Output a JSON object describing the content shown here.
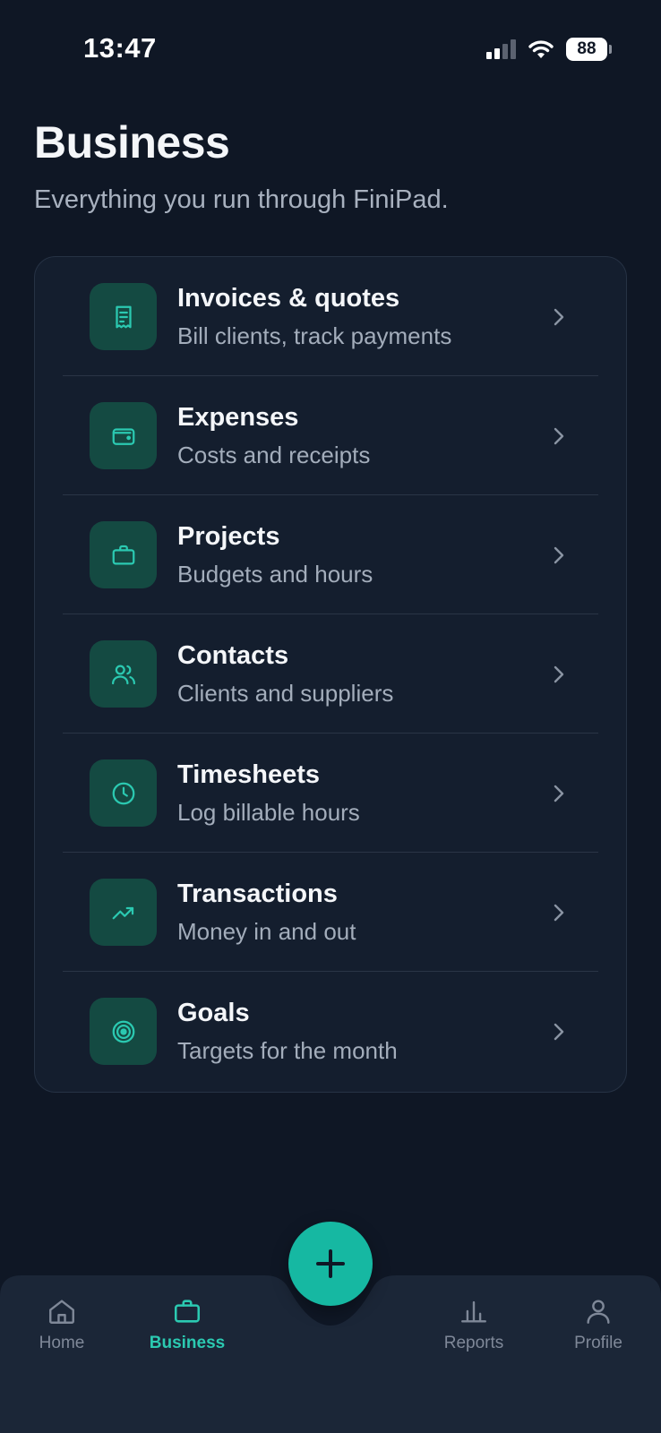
{
  "status_bar": {
    "time": "13:47",
    "battery": "88"
  },
  "header": {
    "title": "Business",
    "subtitle": "Everything you run through FiniPad."
  },
  "menu": {
    "items": [
      {
        "title": "Invoices & quotes",
        "subtitle": "Bill clients, track payments",
        "icon": "receipt-icon"
      },
      {
        "title": "Expenses",
        "subtitle": "Costs and receipts",
        "icon": "wallet-icon"
      },
      {
        "title": "Projects",
        "subtitle": "Budgets and hours",
        "icon": "briefcase-icon"
      },
      {
        "title": "Contacts",
        "subtitle": "Clients and suppliers",
        "icon": "users-icon"
      },
      {
        "title": "Timesheets",
        "subtitle": "Log billable hours",
        "icon": "clock-icon"
      },
      {
        "title": "Transactions",
        "subtitle": "Money in and out",
        "icon": "trending-up-icon"
      },
      {
        "title": "Goals",
        "subtitle": "Targets for the month",
        "icon": "target-icon"
      }
    ]
  },
  "tabbar": {
    "tabs": [
      {
        "label": "Home",
        "icon": "home-icon",
        "active": false
      },
      {
        "label": "Business",
        "icon": "briefcase-icon",
        "active": true
      },
      {
        "label": "Reports",
        "icon": "bar-chart-icon",
        "active": false
      },
      {
        "label": "Profile",
        "icon": "user-icon",
        "active": false
      }
    ],
    "fab_icon": "plus-icon"
  },
  "colors": {
    "background": "#0f1725",
    "card": "#141e2e",
    "accent": "#16b8a2",
    "icon_tile": "#144a42",
    "active_tab": "#2bc9b1"
  }
}
